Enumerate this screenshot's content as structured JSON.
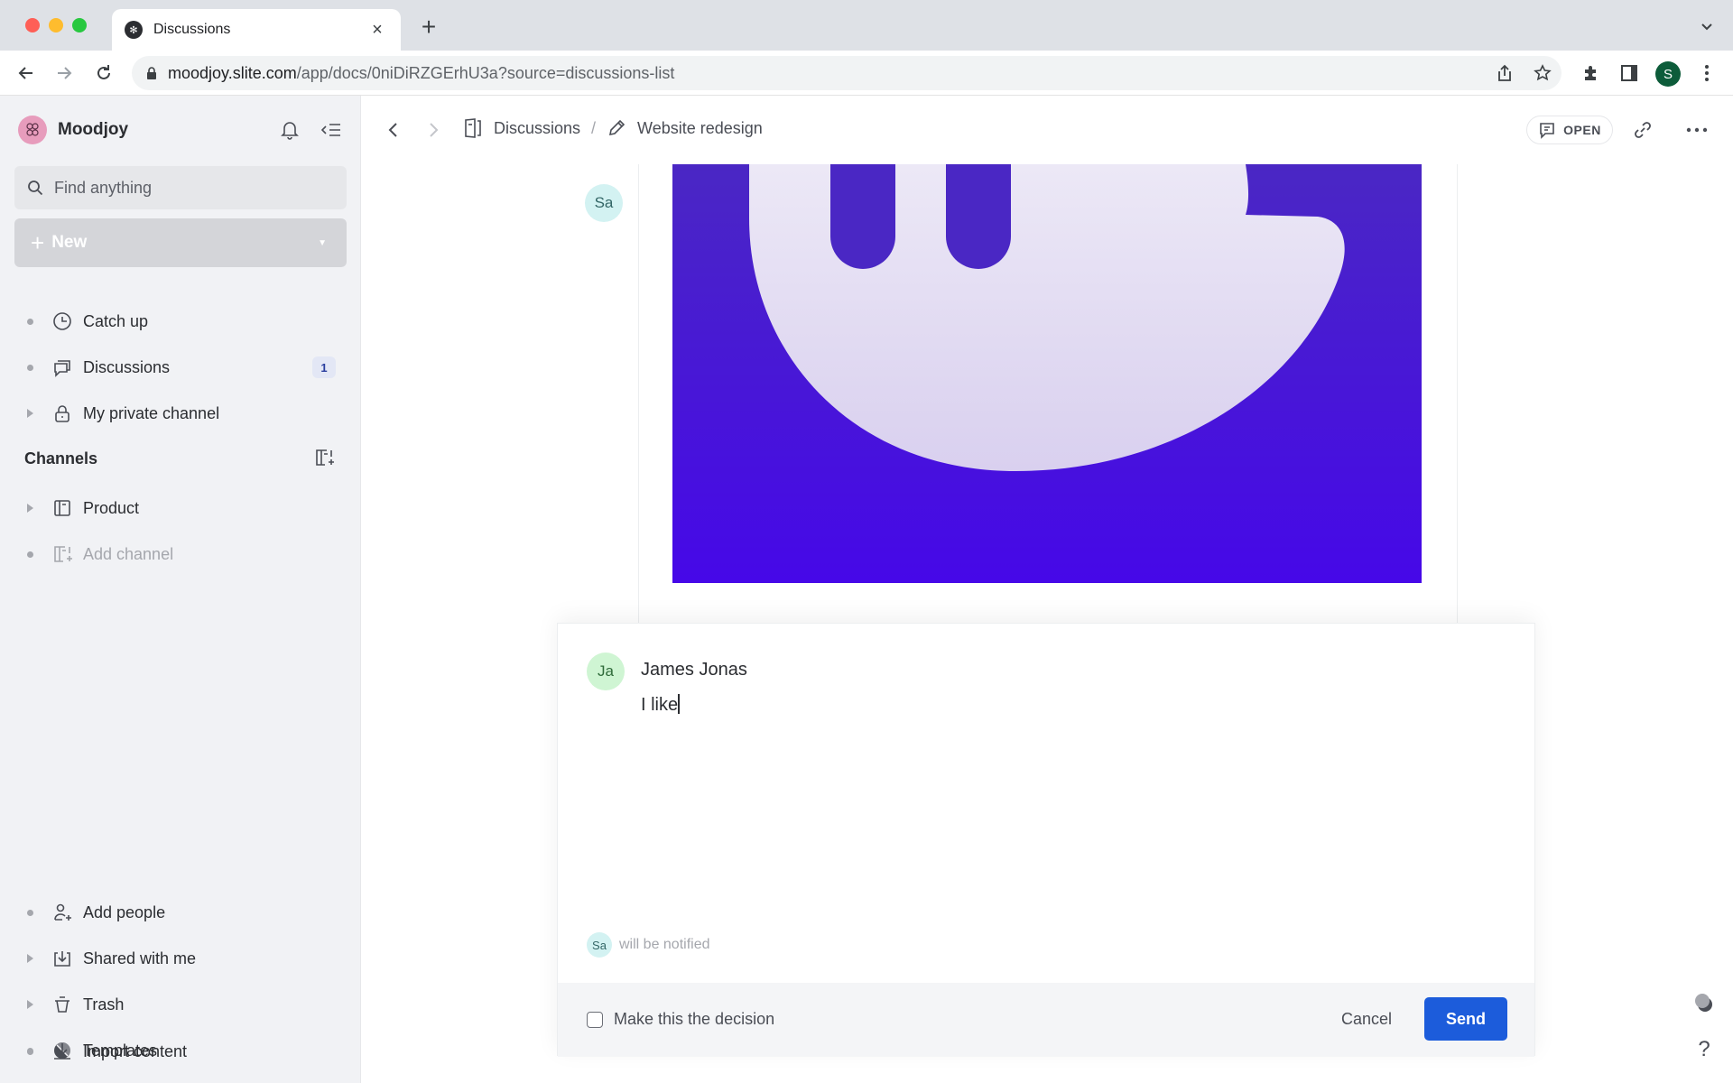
{
  "browser": {
    "tab_title": "Discussions",
    "tab_close": "×",
    "new_tab": "+",
    "url_host": "moodjoy.slite.com",
    "url_path": "/app/docs/0niDiRZGErhU3a?source=discussions-list",
    "profile_initial": "S",
    "colors": {
      "profile_bg": "#0d5c3a"
    }
  },
  "sidebar": {
    "workspace_name": "Moodjoy",
    "search_placeholder": "Find anything",
    "new_button": "New",
    "items": [
      {
        "label": "Catch up",
        "icon": "clock-icon",
        "marker": "dot"
      },
      {
        "label": "Discussions",
        "icon": "discussions-icon",
        "marker": "dot",
        "badge": "1"
      },
      {
        "label": "My private channel",
        "icon": "lock-icon",
        "marker": "arrow"
      }
    ],
    "channels_title": "Channels",
    "channels": [
      {
        "label": "Product",
        "icon": "channel-icon",
        "marker": "arrow"
      },
      {
        "label": "Add channel",
        "icon": "add-channel-icon",
        "marker": "dot",
        "muted": true
      }
    ],
    "bottom_items": [
      {
        "label": "Add people",
        "icon": "add-person-icon",
        "marker": "dot"
      },
      {
        "label": "Shared with me",
        "icon": "inbox-download-icon",
        "marker": "arrow"
      },
      {
        "label": "Trash",
        "icon": "trash-icon",
        "marker": "arrow"
      },
      {
        "label": "Templates",
        "icon": "templates-icon",
        "marker": "dot"
      },
      {
        "label": "Import content",
        "icon": "import-icon",
        "marker": "dot"
      }
    ]
  },
  "topbar": {
    "breadcrumb": [
      {
        "label": "Discussions",
        "icon": "discussions-doc-icon"
      },
      {
        "label": "Website redesign",
        "icon": "pencil-icon"
      }
    ],
    "separator": "/",
    "status_button": "OPEN"
  },
  "thread": {
    "poster_initials": "Sa",
    "image_colors": {
      "top": "#4a27c4",
      "bottom": "#4608e8",
      "shape": "#e6e0f5"
    }
  },
  "composer": {
    "author_initials": "Ja",
    "author_name": "James Jonas",
    "message": "I like",
    "notify_initials": "Sa",
    "notify_text": "will be notified",
    "decision_label": "Make this the decision",
    "decision_checked": false,
    "cancel_label": "Cancel",
    "send_label": "Send",
    "colors": {
      "send_bg": "#1c5cdb"
    }
  },
  "help": {
    "label": "?"
  }
}
